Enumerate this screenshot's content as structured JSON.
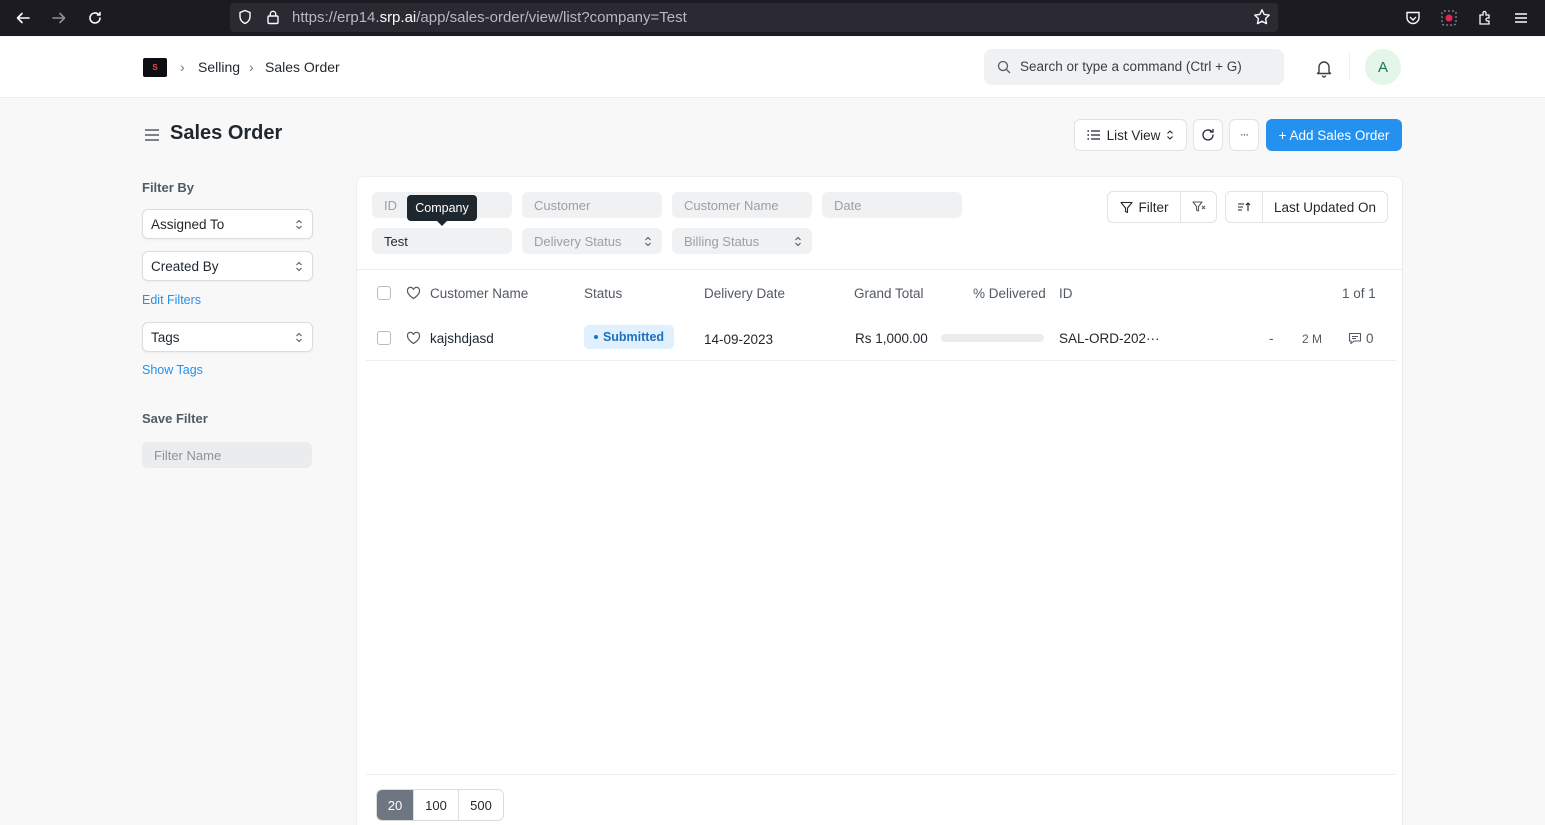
{
  "browser": {
    "url_prefix": "https://erp14.",
    "url_domain": "srp.ai",
    "url_path": "/app/sales-order/view/list?company=Test"
  },
  "navbar": {
    "logo_text": "S",
    "breadcrumbs": [
      "Selling",
      "Sales Order"
    ],
    "search_placeholder": "Search or type a command (Ctrl + G)",
    "avatar_initial": "A"
  },
  "page": {
    "title": "Sales Order",
    "view_switcher_label": "List View",
    "more_label": "···",
    "add_button_label": "+ Add Sales Order"
  },
  "sidebar": {
    "filter_by_label": "Filter By",
    "assigned_to_label": "Assigned To",
    "created_by_label": "Created By",
    "edit_filters_label": "Edit Filters",
    "tags_label": "Tags",
    "show_tags_label": "Show Tags",
    "save_filter_label": "Save Filter",
    "filter_name_placeholder": "Filter Name"
  },
  "filters": {
    "id_placeholder": "ID",
    "customer_placeholder": "Customer",
    "customer_name_placeholder": "Customer Name",
    "date_placeholder": "Date",
    "company_value": "Test",
    "company_tooltip": "Company",
    "delivery_status_placeholder": "Delivery Status",
    "billing_status_placeholder": "Billing Status",
    "filter_button_label": "Filter",
    "sort_label": "Last Updated On"
  },
  "table": {
    "columns": {
      "customer_name": "Customer Name",
      "status": "Status",
      "delivery_date": "Delivery Date",
      "grand_total": "Grand Total",
      "percent_delivered": "% Delivered",
      "id": "ID"
    },
    "count_label": "1 of 1",
    "rows": [
      {
        "customer_name": "kajshdjasd",
        "status": "Submitted",
        "delivery_date": "14-09-2023",
        "grand_total": "Rs 1,000.00",
        "percent_delivered": 0,
        "id": "SAL-ORD-202···",
        "assigned": "-",
        "modified": "2 M",
        "comments": "0"
      }
    ]
  },
  "paging": {
    "sizes": [
      "20",
      "100",
      "500"
    ],
    "active": "20"
  },
  "colors": {
    "primary": "#2490ef",
    "status_submitted_bg": "#e0f0ff",
    "status_submitted_text": "#1f6fba"
  }
}
